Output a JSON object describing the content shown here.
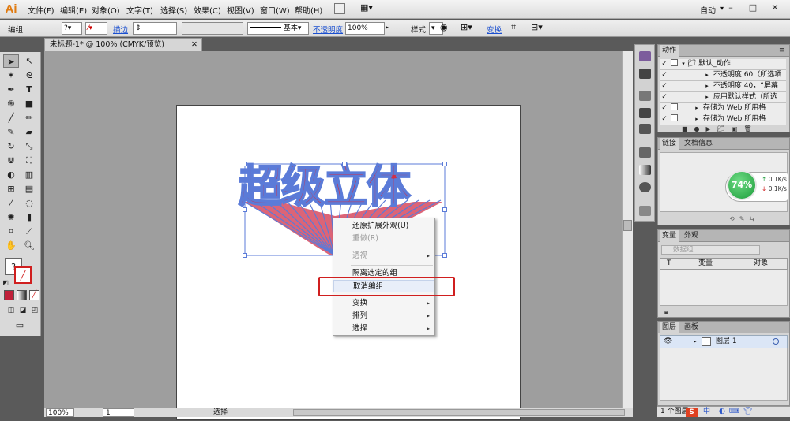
{
  "app": {
    "logo": "Ai",
    "menus": [
      "文件(F)",
      "编辑(E)",
      "对象(O)",
      "文字(T)",
      "选择(S)",
      "效果(C)",
      "视图(V)",
      "窗口(W)",
      "帮助(H)"
    ],
    "workspace": "自动",
    "window_controls": [
      "–",
      "□",
      "✕"
    ]
  },
  "control_bar": {
    "selection_label": "编组",
    "stroke_label": "描边",
    "stroke_style": "基本",
    "opacity_label": "不透明度",
    "opacity_value": "100%",
    "style_label": "样式",
    "transform_label": "变换"
  },
  "document": {
    "tab_title": "未标题-1* @ 100% (CMYK/预览)",
    "artwork_text": "超级立体",
    "artwork_colors": {
      "fill": "#d0304a",
      "outline": "#5b7bd8"
    },
    "status_zoom": "100%",
    "status_page": "1",
    "status_tool": "选择"
  },
  "context_menu": {
    "items": [
      {
        "label": "还原扩展外观(U)",
        "enabled": true,
        "submenu": false
      },
      {
        "label": "重做(R)",
        "enabled": false,
        "submenu": false
      },
      {
        "label": "透视",
        "enabled": false,
        "submenu": true
      },
      {
        "label": "隔离选定的组",
        "enabled": true,
        "submenu": false
      },
      {
        "label": "取消编组",
        "enabled": true,
        "submenu": false
      },
      {
        "label": "变换",
        "enabled": true,
        "submenu": true
      },
      {
        "label": "排列",
        "enabled": true,
        "submenu": true
      },
      {
        "label": "选择",
        "enabled": true,
        "submenu": true
      }
    ],
    "highlighted": "取消编组",
    "highlight_color": "#d01f1f"
  },
  "actions_panel": {
    "tab": "动作",
    "rows": [
      "默认_动作",
      "不透明度 60（所选项",
      "不透明度 40，“屏幕",
      "应用默认样式（所选",
      "存储为 Web 所用格",
      "存储为 Web 所用格"
    ]
  },
  "links_panel": {
    "tabs": [
      "链接",
      "文档信息"
    ]
  },
  "net_widget": {
    "percent": "74%",
    "up_rate": "0.1K/s",
    "down_rate": "0.1K/s"
  },
  "variables_panel": {
    "tabs": [
      "变量",
      "外观"
    ],
    "dataset_placeholder": "数据组",
    "columns": [
      "T",
      "变量",
      "对象"
    ]
  },
  "layers_panel": {
    "tabs": [
      "图层",
      "画板"
    ],
    "layer_name": "图层 1",
    "footer": "1 个图层"
  },
  "tray": {
    "ime": "中"
  }
}
